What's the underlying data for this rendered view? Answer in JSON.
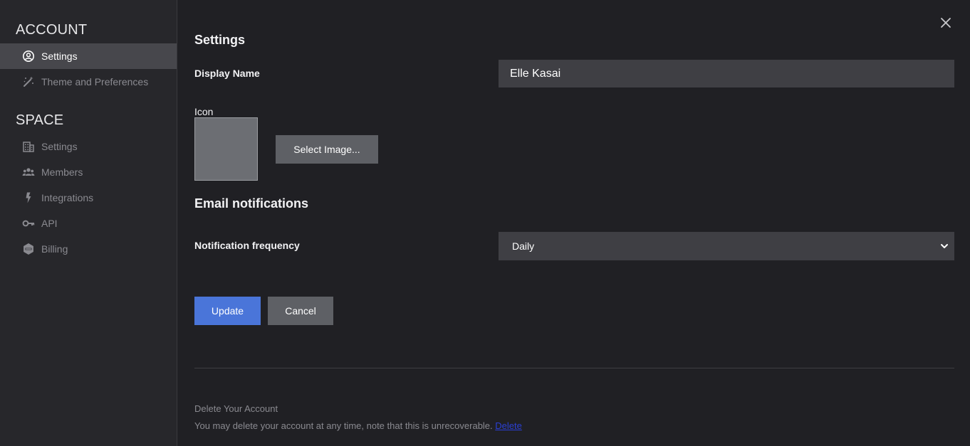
{
  "sidebar": {
    "account_title": "ACCOUNT",
    "account_items": [
      {
        "label": "Settings",
        "icon": "user-circle-icon"
      },
      {
        "label": "Theme and Preferences",
        "icon": "magic-wand-icon"
      }
    ],
    "space_title": "SPACE",
    "space_items": [
      {
        "label": "Settings",
        "icon": "building-icon"
      },
      {
        "label": "Members",
        "icon": "users-icon"
      },
      {
        "label": "Integrations",
        "icon": "bolt-icon"
      },
      {
        "label": "API",
        "icon": "key-icon"
      },
      {
        "label": "Billing",
        "icon": "pro-badge-icon"
      }
    ]
  },
  "main": {
    "title": "Settings",
    "display_name_label": "Display Name",
    "display_name_value": "Elle Kasai",
    "icon_label": "Icon",
    "select_image_label": "Select Image...",
    "email_title": "Email notifications",
    "frequency_label": "Notification frequency",
    "frequency_value": "Daily",
    "update_label": "Update",
    "cancel_label": "Cancel",
    "delete_title": "Delete Your Account",
    "delete_text": "You may delete your account at any time, note that this is unrecoverable.",
    "delete_link": "Delete"
  },
  "colors": {
    "background": "#202024",
    "sidebar": "#27272b",
    "active_item": "#47474c",
    "primary_button": "#4a75d9",
    "secondary_button": "#5e6065",
    "link": "#2a3fd4"
  }
}
